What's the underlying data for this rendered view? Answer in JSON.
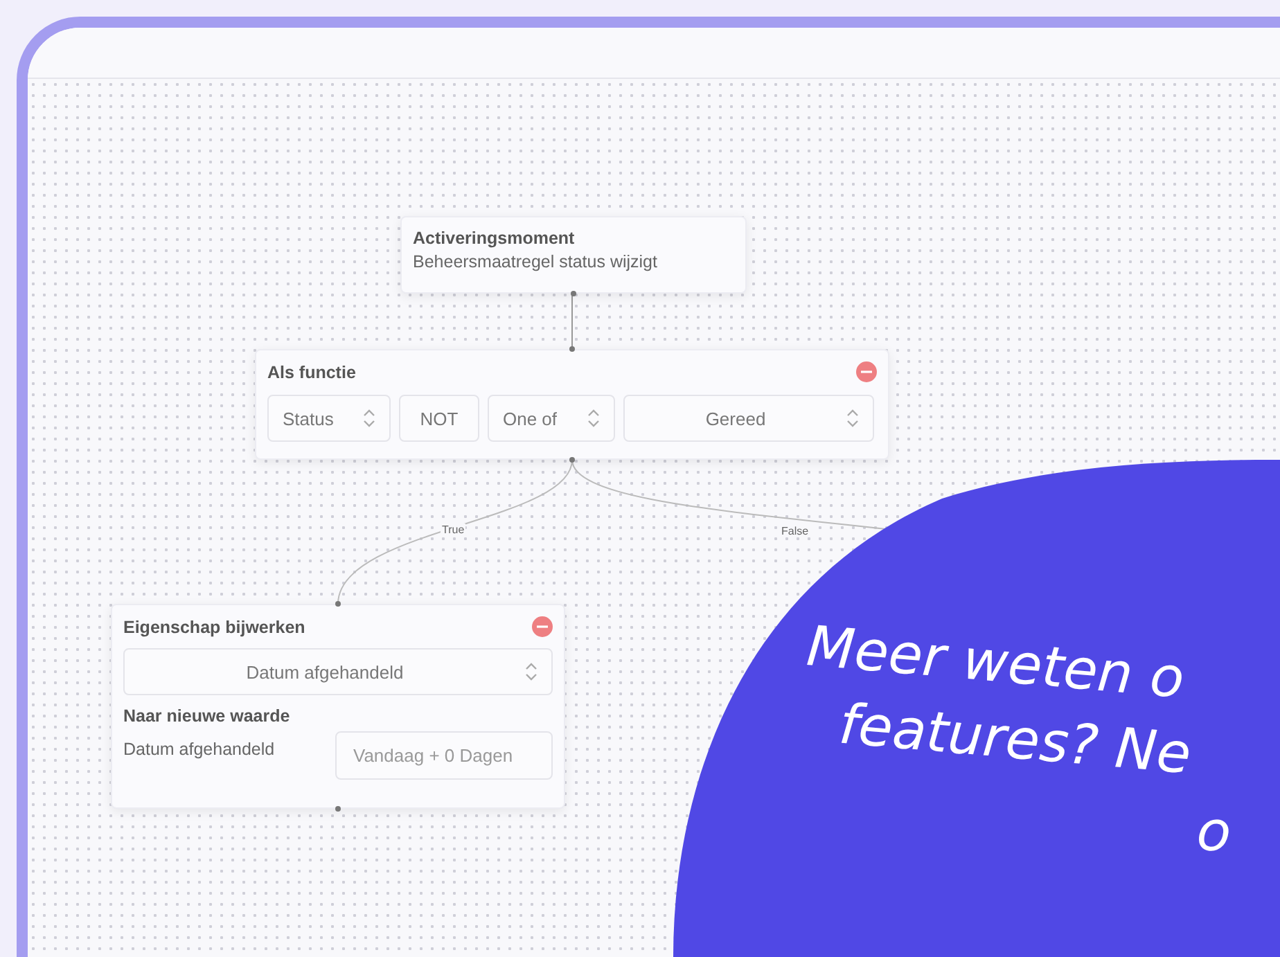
{
  "flow": {
    "trigger": {
      "title": "Activeringsmoment",
      "subtitle": "Beheersmaatregel status wijzigt"
    },
    "condition": {
      "title": "Als functie",
      "controls": [
        {
          "kind": "select",
          "value": "Status"
        },
        {
          "kind": "toggle",
          "value": "NOT"
        },
        {
          "kind": "select",
          "value": "One of"
        },
        {
          "kind": "select",
          "value": "Gereed"
        }
      ]
    },
    "edges": [
      {
        "label": "True"
      },
      {
        "label": "False"
      }
    ],
    "action": {
      "title": "Eigenschap bijwerken",
      "property": "Datum afgehandeld",
      "section": "Naar nieuwe waarde",
      "field_label": "Datum afgehandeld",
      "field_value": "Vandaag + 0 Dagen"
    }
  },
  "promo": {
    "lines": [
      "Meer weten o",
      "features? Ne",
      "o"
    ]
  }
}
